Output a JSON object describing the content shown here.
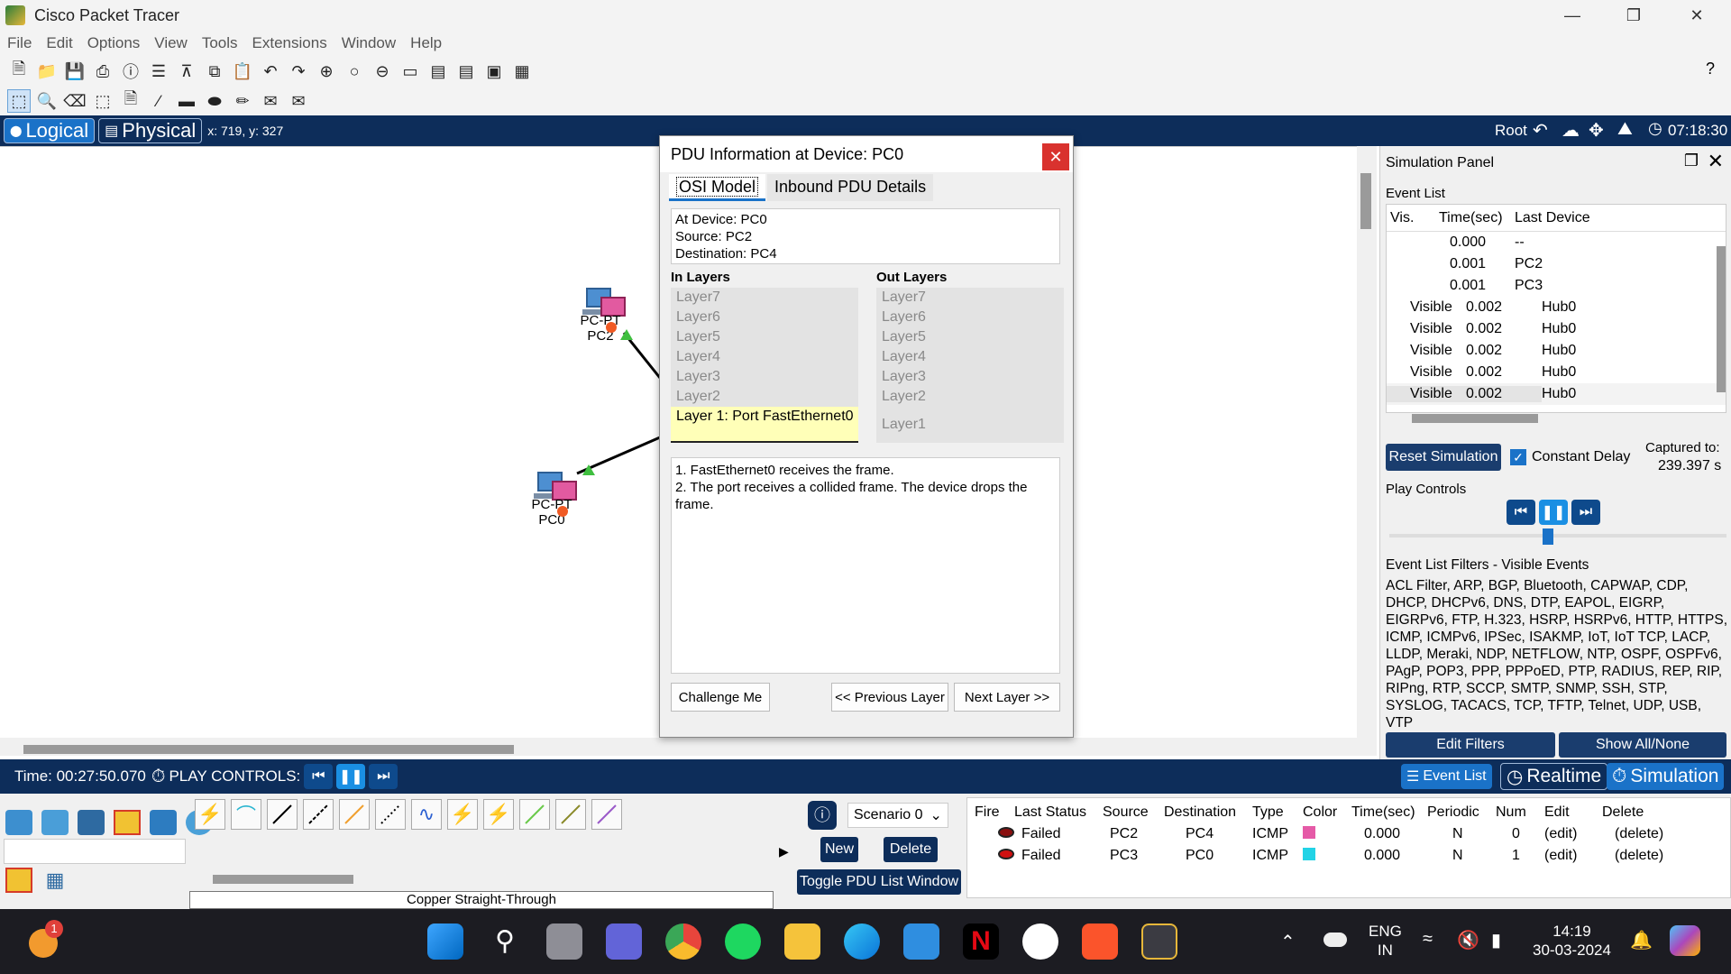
{
  "window": {
    "title": "Cisco Packet Tracer"
  },
  "menu": [
    "File",
    "Edit",
    "Options",
    "View",
    "Tools",
    "Extensions",
    "Window",
    "Help"
  ],
  "help_mark": "?",
  "viewbar": {
    "logical": "Logical",
    "physical": "Physical",
    "coords": "x: 719, y: 327",
    "root": "Root",
    "clock": "07:18:30"
  },
  "devices": [
    {
      "name_top": "PC-PT",
      "name": "PC2"
    },
    {
      "name_top": "PC-PT",
      "name": "PC0"
    }
  ],
  "pdu_dialog": {
    "title": "PDU Information at Device: PC0",
    "tabs": [
      "OSI Model",
      "Inbound PDU Details"
    ],
    "info": [
      "At Device: PC0",
      "Source: PC2",
      "Destination: PC4"
    ],
    "in_layers_title": "In Layers",
    "out_layers_title": "Out Layers",
    "in_layers": [
      "Layer7",
      "Layer6",
      "Layer5",
      "Layer4",
      "Layer3",
      "Layer2"
    ],
    "in_layer1": "Layer 1: Port FastEthernet0",
    "out_layers": [
      "Layer7",
      "Layer6",
      "Layer5",
      "Layer4",
      "Layer3",
      "Layer2",
      "Layer1"
    ],
    "description": [
      "1. FastEthernet0 receives the frame.",
      "2. The port receives a collided frame. The device drops the frame."
    ],
    "buttons": {
      "challenge": "Challenge Me",
      "prev": "<< Previous Layer",
      "next": "Next Layer >>"
    }
  },
  "sim_panel": {
    "title": "Simulation Panel",
    "event_list_label": "Event List",
    "columns": [
      "Vis.",
      "Time(sec)",
      "Last Device"
    ],
    "events": [
      {
        "vis": "",
        "time": "0.000",
        "device": "--"
      },
      {
        "vis": "",
        "time": "0.001",
        "device": "PC2"
      },
      {
        "vis": "",
        "time": "0.001",
        "device": "PC3"
      },
      {
        "vis": "Visible",
        "time": "0.002",
        "device": "Hub0"
      },
      {
        "vis": "Visible",
        "time": "0.002",
        "device": "Hub0"
      },
      {
        "vis": "Visible",
        "time": "0.002",
        "device": "Hub0"
      },
      {
        "vis": "Visible",
        "time": "0.002",
        "device": "Hub0"
      },
      {
        "vis": "Visible",
        "time": "0.002",
        "device": "Hub0"
      }
    ],
    "reset": "Reset Simulation",
    "constant_delay": "Constant Delay",
    "captured_label": "Captured to:",
    "captured_value": "239.397 s",
    "play_controls": "Play Controls",
    "filters_title": "Event List Filters - Visible Events",
    "filters_text": "ACL Filter, ARP, BGP, Bluetooth, CAPWAP, CDP, DHCP, DHCPv6, DNS, DTP, EAPOL, EIGRP, EIGRPv6, FTP, H.323, HSRP, HSRPv6, HTTP, HTTPS, ICMP, ICMPv6, IPSec, ISAKMP, IoT, IoT TCP, LACP, LLDP, Meraki, NDP, NETFLOW, NTP, OSPF, OSPFv6, PAgP, POP3, PPP, PPPoED, PTP, RADIUS, REP, RIP, RIPng, RTP, SCCP, SMTP, SNMP, SSH, STP, SYSLOG, TACACS, TCP, TFTP, Telnet, UDP, USB, VTP",
    "edit_filters": "Edit Filters",
    "show_all": "Show All/None"
  },
  "timebar": {
    "time": "Time: 00:27:50.070",
    "play_controls": "PLAY CONTROLS:",
    "event_list": "Event List",
    "realtime": "Realtime",
    "simulation": "Simulation"
  },
  "bottom": {
    "cable_label": "Copper Straight-Through",
    "scenario": "Scenario 0",
    "new": "New",
    "delete": "Delete",
    "toggle": "Toggle PDU List Window",
    "pdu_columns": [
      "Fire",
      "Last Status",
      "Source",
      "Destination",
      "Type",
      "Color",
      "Time(sec)",
      "Periodic",
      "Num",
      "Edit",
      "Delete"
    ],
    "pdu_rows": [
      {
        "status": "Failed",
        "source": "PC2",
        "dest": "PC4",
        "type": "ICMP",
        "color": "#e55aa7",
        "time": "0.000",
        "periodic": "N",
        "num": "0",
        "edit": "(edit)",
        "delete": "(delete)"
      },
      {
        "status": "Failed",
        "source": "PC3",
        "dest": "PC0",
        "type": "ICMP",
        "color": "#22d3e6",
        "time": "0.000",
        "periodic": "N",
        "num": "1",
        "edit": "(edit)",
        "delete": "(delete)"
      }
    ]
  },
  "taskbar": {
    "badge": "1",
    "lang1": "ENG",
    "lang2": "IN",
    "time": "14:19",
    "date": "30-03-2024"
  }
}
